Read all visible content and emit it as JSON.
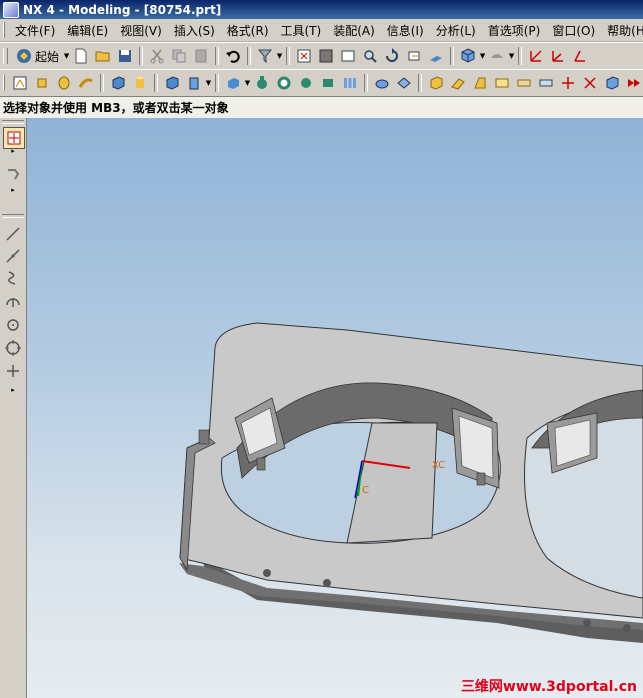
{
  "window": {
    "title": "NX 4 - Modeling - [80754.prt]"
  },
  "menu": {
    "items": [
      "文件(F)",
      "编辑(E)",
      "视图(V)",
      "插入(S)",
      "格式(R)",
      "工具(T)",
      "装配(A)",
      "信息(I)",
      "分析(L)",
      "首选项(P)",
      "窗口(O)",
      "帮助(H)"
    ]
  },
  "toolbar": {
    "start_label": "起始"
  },
  "cue": {
    "text": "选择对象并使用 MB3，或者双击某一对象"
  },
  "viewport": {
    "axis_label_xc": "XC",
    "axis_label_c": "C"
  },
  "watermark": {
    "text": "三维网www.3dportal.cn"
  },
  "colors": {
    "title_bar": "#0a246a",
    "chrome": "#d4d0c8",
    "part_top": "#c8c8c8",
    "part_side": "#6e6e6e",
    "axis_x": "#e00000",
    "axis_y": "#00a000",
    "axis_z": "#0000e0"
  }
}
